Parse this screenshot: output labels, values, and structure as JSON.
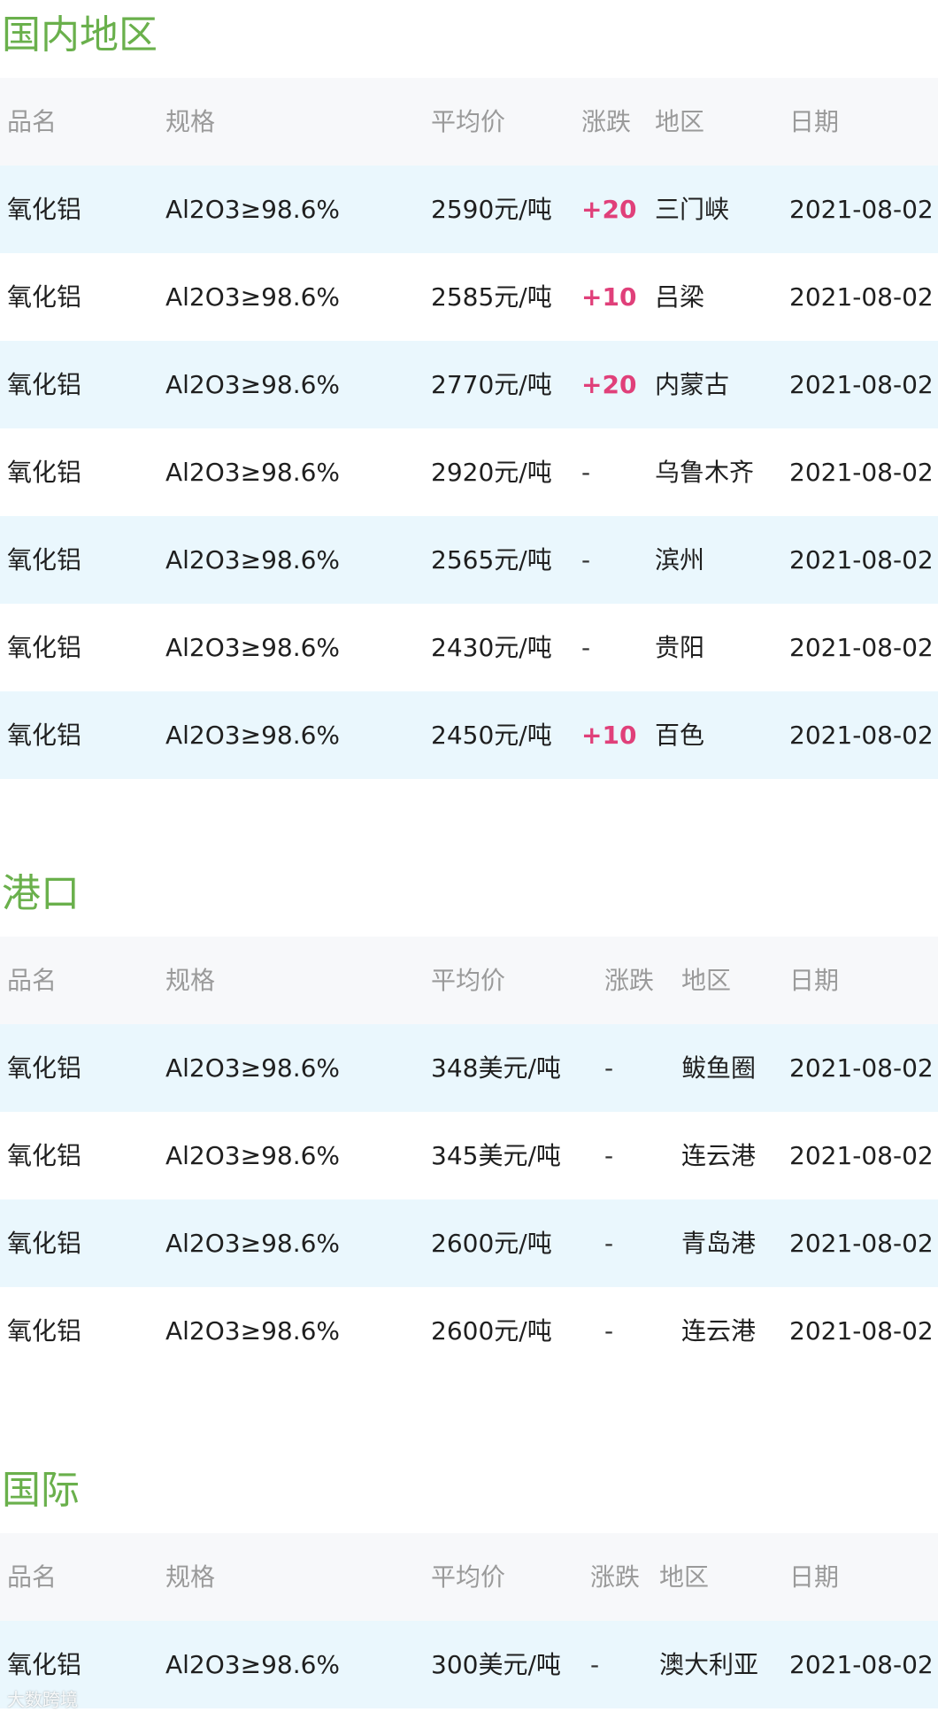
{
  "sections": [
    {
      "id": "domestic",
      "title": "国内地区",
      "headers": {
        "name": "品名",
        "spec": "规格",
        "price": "平均价",
        "change": "涨跌",
        "region": "地区",
        "date": "日期"
      },
      "rows": [
        {
          "name": "氧化铝",
          "spec": "Al2O3≥98.6%",
          "price": "2590元/吨",
          "change": "+20",
          "region": "三门峡",
          "date": "2021-08-02"
        },
        {
          "name": "氧化铝",
          "spec": "Al2O3≥98.6%",
          "price": "2585元/吨",
          "change": "+10",
          "region": "吕梁",
          "date": "2021-08-02"
        },
        {
          "name": "氧化铝",
          "spec": "Al2O3≥98.6%",
          "price": "2770元/吨",
          "change": "+20",
          "region": "内蒙古",
          "date": "2021-08-02"
        },
        {
          "name": "氧化铝",
          "spec": "Al2O3≥98.6%",
          "price": "2920元/吨",
          "change": "-",
          "region": "乌鲁木齐",
          "date": "2021-08-02"
        },
        {
          "name": "氧化铝",
          "spec": "Al2O3≥98.6%",
          "price": "2565元/吨",
          "change": "-",
          "region": "滨州",
          "date": "2021-08-02"
        },
        {
          "name": "氧化铝",
          "spec": "Al2O3≥98.6%",
          "price": "2430元/吨",
          "change": "-",
          "region": "贵阳",
          "date": "2021-08-02"
        },
        {
          "name": "氧化铝",
          "spec": "Al2O3≥98.6%",
          "price": "2450元/吨",
          "change": "+10",
          "region": "百色",
          "date": "2021-08-02"
        }
      ]
    },
    {
      "id": "port",
      "title": "港口",
      "headers": {
        "name": "品名",
        "spec": "规格",
        "price": "平均价",
        "change": "涨跌",
        "region": "地区",
        "date": "日期"
      },
      "rows": [
        {
          "name": "氧化铝",
          "spec": "Al2O3≥98.6%",
          "price": "348美元/吨",
          "change": "-",
          "region": "鲅鱼圈",
          "date": "2021-08-02"
        },
        {
          "name": "氧化铝",
          "spec": "Al2O3≥98.6%",
          "price": "345美元/吨",
          "change": "-",
          "region": "连云港",
          "date": "2021-08-02"
        },
        {
          "name": "氧化铝",
          "spec": "Al2O3≥98.6%",
          "price": "2600元/吨",
          "change": "-",
          "region": "青岛港",
          "date": "2021-08-02"
        },
        {
          "name": "氧化铝",
          "spec": "Al2O3≥98.6%",
          "price": "2600元/吨",
          "change": "-",
          "region": "连云港",
          "date": "2021-08-02"
        }
      ]
    },
    {
      "id": "international",
      "title": "国际",
      "headers": {
        "name": "品名",
        "spec": "规格",
        "price": "平均价",
        "change": "涨跌",
        "region": "地区",
        "date": "日期"
      },
      "rows": [
        {
          "name": "氧化铝",
          "spec": "Al2O3≥98.6%",
          "price": "300美元/吨",
          "change": "-",
          "region": "澳大利亚",
          "date": "2021-08-02"
        }
      ]
    }
  ],
  "watermark": "大数跨境",
  "colors": {
    "title": "#6ab04c",
    "rise": "#e0407a",
    "row_alt": "#eaf7fd",
    "header_bg": "#f7f8fa"
  }
}
